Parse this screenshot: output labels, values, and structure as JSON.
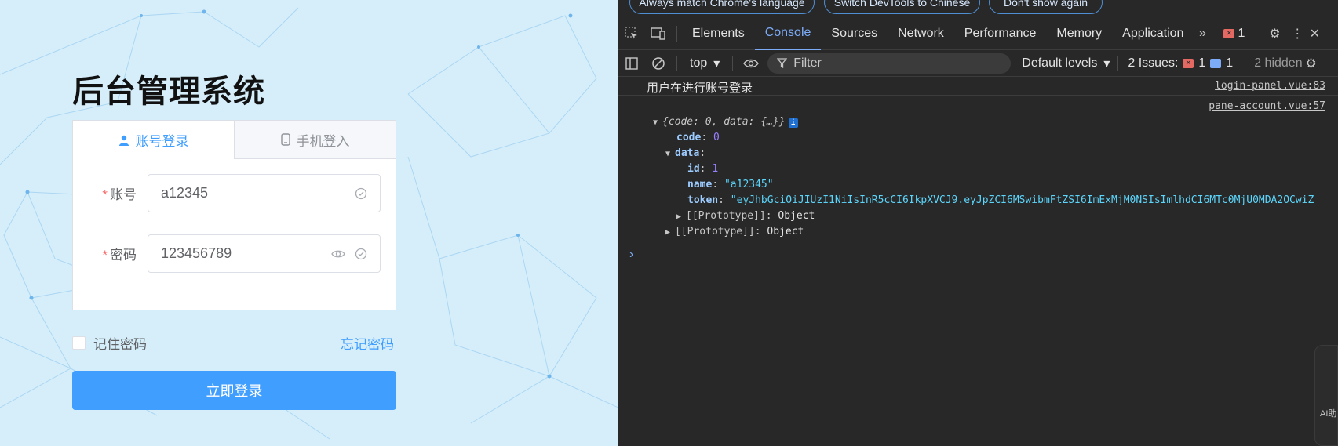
{
  "login": {
    "title": "后台管理系统",
    "tabs": [
      {
        "label": "账号登录",
        "icon": "user-icon",
        "active": true
      },
      {
        "label": "手机登入",
        "icon": "phone-icon",
        "active": false
      }
    ],
    "account": {
      "label": "账号",
      "required_mark": "*",
      "value": "a12345"
    },
    "password": {
      "label": "密码",
      "required_mark": "*",
      "value": "123456789"
    },
    "remember_label": "记住密码",
    "forgot_label": "忘记密码",
    "submit_label": "立即登录",
    "accent_color": "#409eff"
  },
  "devtools": {
    "notice_buttons": [
      "Always match Chrome's language",
      "Switch DevTools to Chinese",
      "Don't show again"
    ],
    "tabs": [
      "Elements",
      "Console",
      "Sources",
      "Network",
      "Performance",
      "Memory",
      "Application"
    ],
    "active_tab": "Console",
    "error_count": "1",
    "toolbar": {
      "context": "top",
      "filter_placeholder": "Filter",
      "levels": "Default levels",
      "issues_label": "2 Issues:",
      "issues_errors": "1",
      "issues_messages": "1",
      "hidden": "2 hidden"
    },
    "console": {
      "log_message": "用户在进行账号登录",
      "log_source": "login-panel.vue:83",
      "obj_source": "pane-account.vue:57",
      "obj_preview": "{code: 0, data: {…}}",
      "code_key": "code",
      "code_value": "0",
      "data_key": "data",
      "id_key": "id",
      "id_value": "1",
      "name_key": "name",
      "name_value": "\"a12345\"",
      "token_key": "token",
      "token_value": "\"eyJhbGciOiJIUzI1NiIsInR5cCI6IkpXVCJ9.eyJpZCI6MSwibmFtZSI6ImExMjM0NSIsImlhdCI6MTc0MjU0MDA2OCwiZ",
      "prototype_label": "[[Prototype]]",
      "prototype_value": "Object"
    },
    "side_widget_label": "AI助"
  }
}
